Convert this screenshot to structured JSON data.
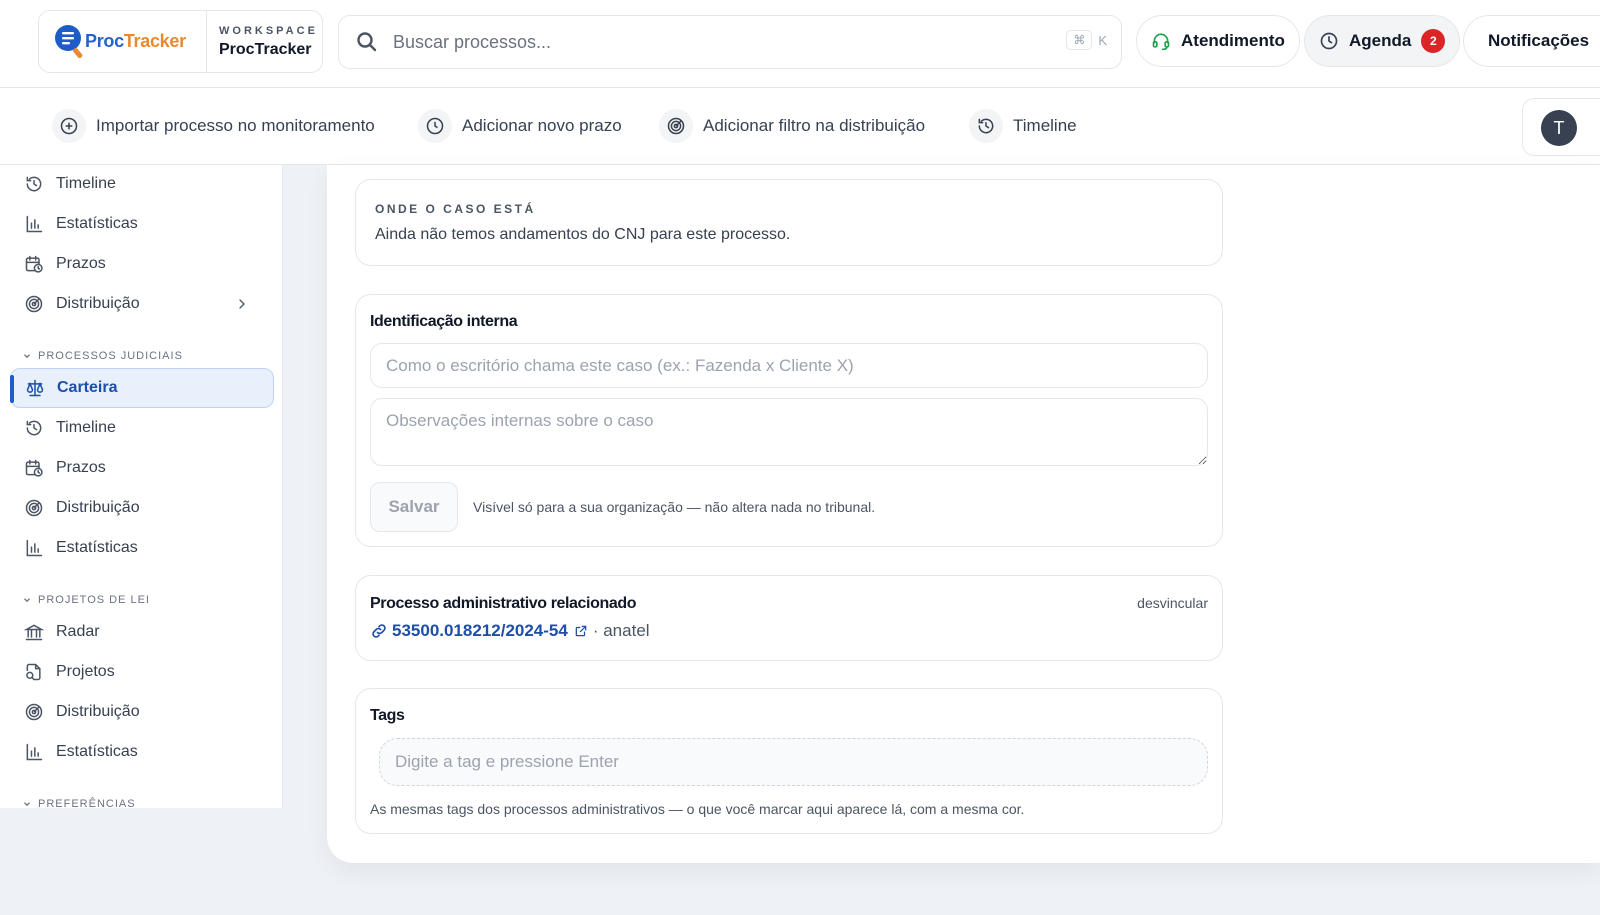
{
  "brand": {
    "logo_a": "Proc",
    "logo_b": "Tracker",
    "workspace_label": "WORKSPACE",
    "workspace_name": "ProcTracker"
  },
  "search": {
    "placeholder": "Buscar processos...",
    "shortcut_key": "⌘",
    "shortcut_letter": "K"
  },
  "header_actions": {
    "support_label": "Atendimento",
    "agenda_label": "Agenda",
    "agenda_count": "2",
    "notifications_label": "Notificações"
  },
  "quick_actions": [
    {
      "label": "Importar processo no monitoramento"
    },
    {
      "label": "Adicionar novo prazo"
    },
    {
      "label": "Adicionar filtro na distribuição"
    },
    {
      "label": "Timeline"
    }
  ],
  "user": {
    "avatar_initial": "T"
  },
  "sidebar": {
    "top_items": [
      "Timeline",
      "Estatísticas",
      "Prazos",
      "Distribuição"
    ],
    "sections": [
      {
        "title": "PROCESSOS JUDICIAIS",
        "items": [
          "Carteira",
          "Timeline",
          "Prazos",
          "Distribuição",
          "Estatísticas"
        ]
      },
      {
        "title": "PROJETOS DE LEI",
        "items": [
          "Radar",
          "Projetos",
          "Distribuição",
          "Estatísticas"
        ]
      },
      {
        "title": "PREFERÊNCIAS"
      }
    ]
  },
  "case_status": {
    "eyebrow": "ONDE O CASO ESTÁ",
    "text": "Ainda não temos andamentos do CNJ para este processo."
  },
  "internal_id": {
    "title": "Identificação interna",
    "name_placeholder": "Como o escritório chama este caso (ex.: Fazenda x Cliente X)",
    "notes_placeholder": "Observações internas sobre o caso",
    "save_label": "Salvar",
    "hint": "Visível só para a sua organização — não altera nada no tribunal."
  },
  "related": {
    "title": "Processo administrativo relacionado",
    "unlink_label": "desvincular",
    "process_number": "53500.018212/2024-54",
    "agency": "· anatel"
  },
  "tags": {
    "title": "Tags",
    "placeholder": "Digite a tag e pressione Enter",
    "hint": "As mesmas tags dos processos administrativos — o que você marcar aqui aparece lá, com a mesma cor."
  }
}
